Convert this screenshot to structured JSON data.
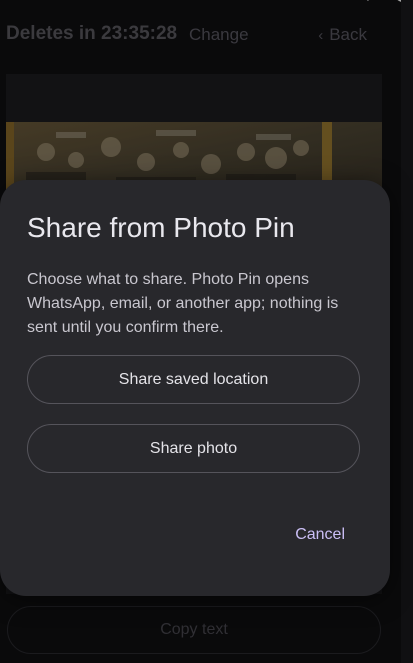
{
  "top_bar": {
    "deletes_label": "Deletes in 23:35:28",
    "change_label": "Change",
    "back_label": "Back"
  },
  "dialog": {
    "title": "Share from Photo Pin",
    "body": "Choose what to share. Photo Pin opens WhatsApp, email, or another app; nothing is sent until you confirm there.",
    "share_location_label": "Share saved location",
    "share_photo_label": "Share photo",
    "cancel_label": "Cancel"
  },
  "bottom": {
    "copy_text_label": "Copy text"
  },
  "colors": {
    "dialog_background": "#28282c",
    "accent": "#cbbff5",
    "screen_background": "#101012"
  },
  "icons": [
    "status-icons",
    "back-chevron-icon"
  ]
}
